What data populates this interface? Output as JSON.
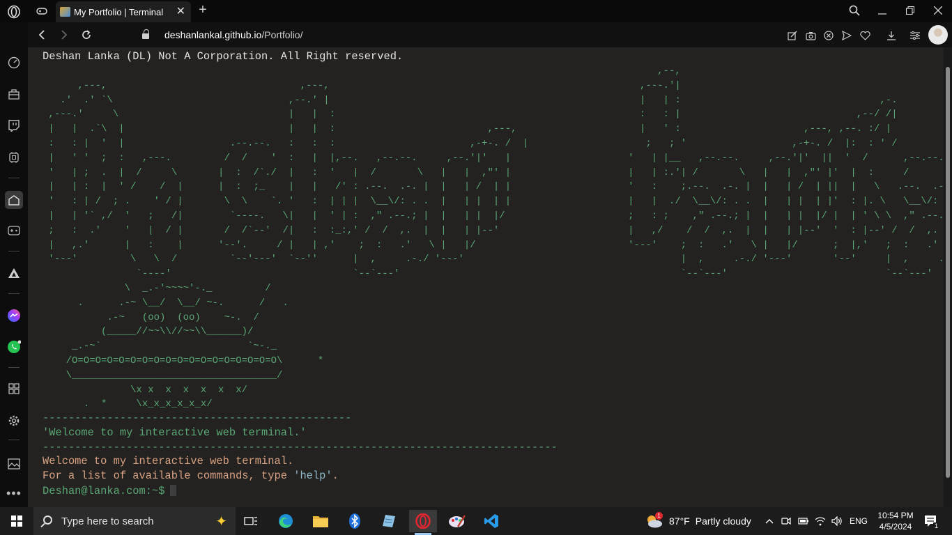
{
  "browser": {
    "tab_title": "My Portfolio | Terminal",
    "url_host": "deshanlankal.github.io",
    "url_path": "/Portfolio/",
    "new_tab": "+",
    "close_tab": "✕"
  },
  "terminal": {
    "copyright": "Deshan Lanka (DL) Not A Corporation. All Right reserved.",
    "banner": "                                                                                                         ,--,\n      ,---,                                 ,---,                                                     ,---.'|\n   .'  .' `\\                              ,--.' |                                                     |   | :                                  ,-.\n ,---.'     \\                             |   |  :                                                    :   : |                              ,--/ /|\n |   |  .`\\  |                            |   |  :                          ,---,                     |   ' :                     ,---, ,--. :/ |\n :   : |  '  |                  .--.--.   :   :  :                       ,-+-. /  |                    ;   ; '                  ,-+-. /  |:  : ' /\n |   ' '  ;  :   ,---.         /  /    '  :   |  |,--.   ,--.--.     ,--.'|'   |                    '   | |__   ,--.--.     ,--.'|'  ||  '  /      ,--.--.\n '   | ;  .  |  /     \\       |  :  /`./  |   :  '   |  /       \\   |   |  ,\"' |                    |   | :.'| /       \\   |   |  ,\"' |'  |  :     /       \\\n |   | :  |  ' /    /  |      |  :  ;_    |   |   /' : .--.  .-. |  |   | /  | |                    '   :    ;.--.  .-. |  |   | /  | ||  |   \\   .--.  .-. |\n '   : | /  ; .    ' / |       \\  \\    `. '   :  | | |  \\__\\/: . .  |   | |  | |                    |   |  ./  \\__\\/: . .  |   | |  | |'  : |. \\   \\__\\/: . .\n |   | '` ,/  '   ;   /|        `----.   \\|   |  ' | :  ,\" .--.; |  |   | |  |/                     ;   : ;    ,\" .--.; |  |   | |  |/ |  | ' \\ \\  ,\" .--.; |\n ;   :  .'    '   |  / |       /  /`--'  /|   :  :_:,' /  /  ,.  |  |   | |--'                      |   ,/    /  /  ,.  |  |   | |--'  '  : |--' /  /  ,.  |\n |   ,.'      |   :    |      '--'.     / |   | ,'    ;  :   .'   \\ |   |/                          '---'    ;  :   .'   \\ |   |/      ;  |,'   ;  :   .'   \\\n '---'         \\   \\  /         `--'---'  `--''      |  ,     .-./ '---'                                     |  ,     .-./ '---'       '--'     |  ,     .-./\n                `----'                               `--`---'                                                `--`---'                           `--`---'\n              \\  _.-'~~~~'-._         /\n      .      .-~ \\__/  \\__/ ~-.      /   .\n           .-~   (oo)  (oo)    ~-.  /\n          (_____//~~\\\\//~~\\\\______)/\n     _.-~`                         `~-._\n    /O=O=O=O=O=O=O=O=O=O=O=O=O=O=O=O=O=O\\      *\n    \\___________________________________/\n               \\x x  x  x  x  x  x/\n       .  *     \\x_x_x_x_x_x/",
    "separator_short": "------------------------------------------------",
    "welcome_quote": "'Welcome to my interactive web terminal.'",
    "separator_long": "--------------------------------------------------------------------------------",
    "welcome": "Welcome to my interactive web terminal.",
    "help_prefix": "For a list of available commands, type ",
    "help_cmd": "'help'",
    "help_suffix": ".",
    "prompt": "Deshan@lanka.com:~$"
  },
  "taskbar": {
    "search_placeholder": "Type here to search",
    "weather_temp": "87°F",
    "weather_desc": "Partly cloudy",
    "weather_badge": "1",
    "language": "ENG",
    "time": "10:54 PM",
    "date": "4/5/2024",
    "notification_count": "1"
  },
  "colors": {
    "terminal_bg": "#232220",
    "ascii_green": "#5aa775",
    "message_orange": "#d9a283",
    "help_blue": "#8fb8c8"
  }
}
